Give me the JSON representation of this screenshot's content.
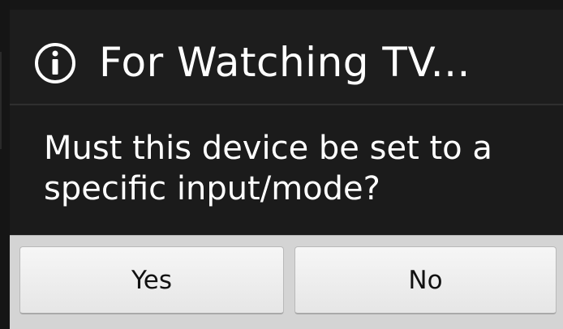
{
  "dialog": {
    "title": "For Watching TV...",
    "icon": "info-icon",
    "message": "Must this device be set to a specific input/mode?"
  },
  "buttons": {
    "yes_label": "Yes",
    "no_label": "No"
  },
  "colors": {
    "dialog_background": "#1b1b1b",
    "title_text": "#ffffff",
    "button_bar": "#d4d4d4",
    "button_face": "#f0f0f0"
  }
}
